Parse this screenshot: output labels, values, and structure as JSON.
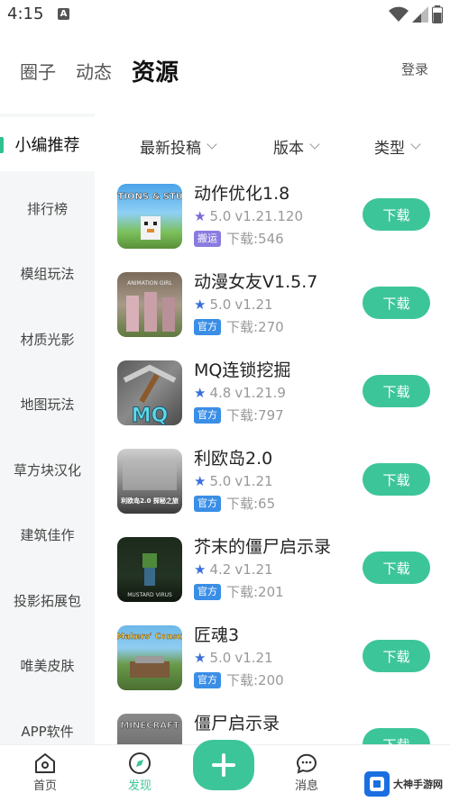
{
  "status_bar": {
    "time": "4:15",
    "a_icon": "A"
  },
  "header": {
    "tabs": [
      "圈子",
      "动态",
      "资源"
    ],
    "active_tab": "资源",
    "login": "登录"
  },
  "sidebar": {
    "items": [
      "小编推荐",
      "排行榜",
      "模组玩法",
      "材质光影",
      "地图玩法",
      "草方块汉化",
      "建筑佳作",
      "投影拓展包",
      "唯美皮肤",
      "APP软件"
    ]
  },
  "filters": [
    {
      "label": "最新投稿"
    },
    {
      "label": "版本"
    },
    {
      "label": "类型"
    }
  ],
  "resources": [
    {
      "title": "动作优化1.8",
      "rating": "5.0",
      "version": "v1.21.120",
      "badge": "搬运",
      "downloads": "下载:546",
      "button": "下载"
    },
    {
      "title": "动漫女友V1.5.7",
      "rating": "5.0",
      "version": "v1.21",
      "badge": "官方",
      "downloads": "下载:270",
      "button": "下载"
    },
    {
      "title": "MQ连锁挖掘",
      "rating": "4.8",
      "version": "v1.21.9",
      "badge": "官方",
      "downloads": "下载:797",
      "button": "下载"
    },
    {
      "title": "利欧岛2.0",
      "rating": "5.0",
      "version": "v1.21",
      "badge": "官方",
      "downloads": "下载:65",
      "button": "下载"
    },
    {
      "title": "芥末的僵尸启示录",
      "rating": "4.2",
      "version": "v1.21",
      "badge": "官方",
      "downloads": "下载:201",
      "button": "下载"
    },
    {
      "title": "匠魂3",
      "rating": "5.0",
      "version": "v1.21",
      "badge": "官方",
      "downloads": "下载:200",
      "button": "下载"
    },
    {
      "title": "僵尸启示录",
      "rating": "",
      "version": "",
      "badge": "",
      "downloads": "",
      "button": "下载"
    }
  ],
  "thumb_texts": [
    "ACTIONS & STUFF",
    "ANIMATION GIRL",
    "MQ",
    "利欧岛2.0 探秘之旅",
    "MUSTARD VIRUS",
    "Makers' Consu",
    "MINECRAFT"
  ],
  "bottom_nav": {
    "home": "首页",
    "discover": "发现",
    "messages": "消息"
  },
  "watermark": {
    "name": "大神手游网"
  },
  "colors": {
    "accent": "#3dc59a",
    "star_blue": "#3a6fd8",
    "star_purple": "#7b69d6",
    "badge_blue": "#3a8ee6",
    "badge_purple": "#8a7be0"
  }
}
